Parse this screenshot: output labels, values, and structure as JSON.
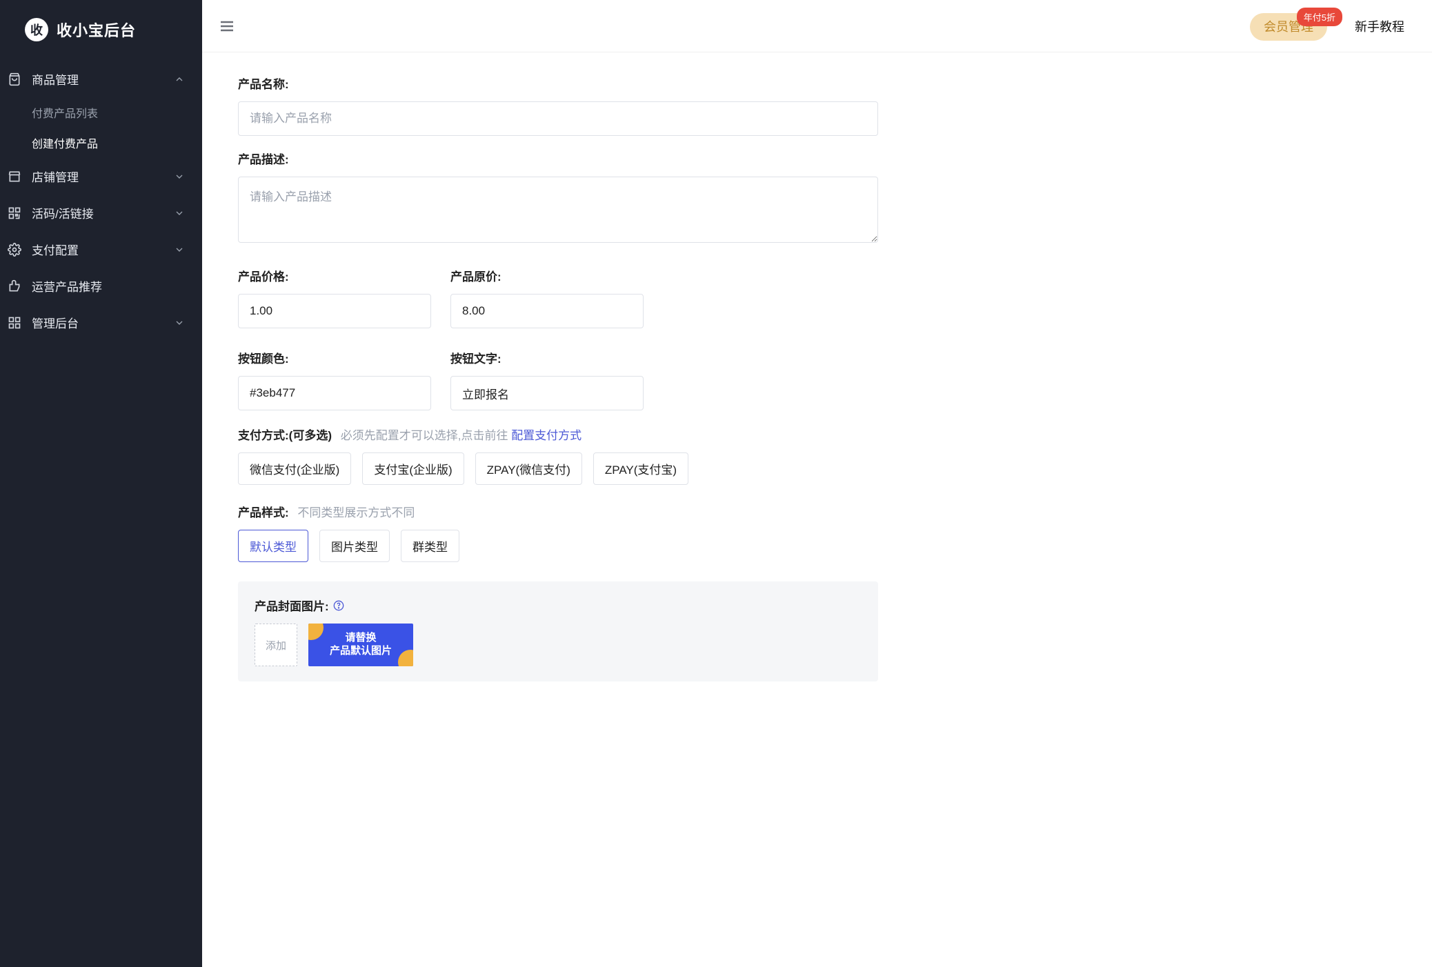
{
  "brand": {
    "logo_text": "收",
    "title": "收小宝后台"
  },
  "sidebar": {
    "items": [
      {
        "label": "商品管理",
        "icon": "bag-icon",
        "expanded": true,
        "children": [
          {
            "label": "付费产品列表",
            "active": false
          },
          {
            "label": "创建付费产品",
            "active": true
          }
        ]
      },
      {
        "label": "店铺管理",
        "icon": "store-icon"
      },
      {
        "label": "活码/活链接",
        "icon": "qr-icon"
      },
      {
        "label": "支付配置",
        "icon": "gear-icon"
      },
      {
        "label": "运营产品推荐",
        "icon": "thumbs-up-icon"
      },
      {
        "label": "管理后台",
        "icon": "grid-icon"
      }
    ]
  },
  "topbar": {
    "member_label": "会员管理",
    "member_badge": "年付5折",
    "tutorial_label": "新手教程"
  },
  "form": {
    "name_label": "产品名称:",
    "name_placeholder": "请输入产品名称",
    "desc_label": "产品描述:",
    "desc_placeholder": "请输入产品描述",
    "price_label": "产品价格:",
    "price_value": "1.00",
    "orig_price_label": "产品原价:",
    "orig_price_value": "8.00",
    "btn_color_label": "按钮颜色:",
    "btn_color_value": "#3eb477",
    "btn_text_label": "按钮文字:",
    "btn_text_value": "立即报名",
    "pay_label": "支付方式:(可多选)",
    "pay_hint_pre": "必须先配置才可以选择,点击前往",
    "pay_config_link": "配置支付方式",
    "pay_options": [
      "微信支付(企业版)",
      "支付宝(企业版)",
      "ZPAY(微信支付)",
      "ZPAY(支付宝)"
    ],
    "style_label": "产品样式:",
    "style_hint": "不同类型展示方式不同",
    "style_options": [
      "默认类型",
      "图片类型",
      "群类型"
    ],
    "style_selected_index": 0,
    "cover_label": "产品封面图片:",
    "add_label": "添加",
    "cover_text_line1": "请替换",
    "cover_text_line2": "产品默认图片"
  }
}
